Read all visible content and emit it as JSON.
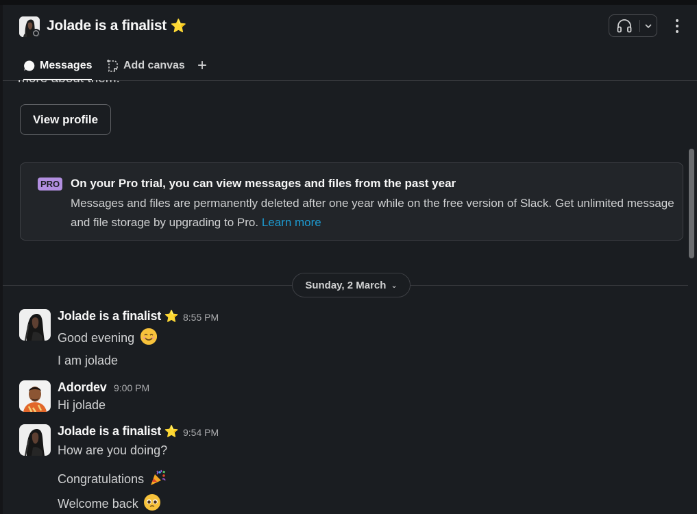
{
  "channel": {
    "title": "Jolade is a finalist",
    "title_emoji": "⭐"
  },
  "tabs": [
    {
      "label": "Messages",
      "active": true
    },
    {
      "label": "Add canvas",
      "active": false
    },
    {
      "label": "+"
    }
  ],
  "intro": {
    "text": "more about them.",
    "view_profile_label": "View profile"
  },
  "pro_banner": {
    "badge": "PRO",
    "title": "On your Pro trial, you can view messages and files from the past year",
    "body": "Messages and files are permanently deleted after one year while on the free version of Slack. Get unlimited message and file storage by upgrading to Pro.",
    "link": "Learn more"
  },
  "date_divider": "Sunday, 2 March",
  "messages": [
    {
      "sender": "Jolade is a finalist",
      "sender_emoji": "⭐",
      "time": "8:55 PM",
      "lines": [
        "Good evening",
        "I am jolade"
      ],
      "emojis": [
        "smiling-face-emoji"
      ]
    },
    {
      "sender": "Adordev",
      "time": "9:00 PM",
      "lines": [
        "Hi jolade"
      ]
    },
    {
      "sender": "Jolade is a finalist",
      "sender_emoji": "⭐",
      "time": "9:54 PM",
      "lines": [
        "How are you doing?",
        "Congratulations",
        "Welcome back"
      ],
      "emojis": [
        "party-popper-emoji",
        "pleading-face-emoji"
      ]
    }
  ],
  "colors": {
    "background": "#1a1d21",
    "link": "#1d9bd1",
    "pro_badge": "#b28fe0",
    "star": "#f2c744"
  }
}
